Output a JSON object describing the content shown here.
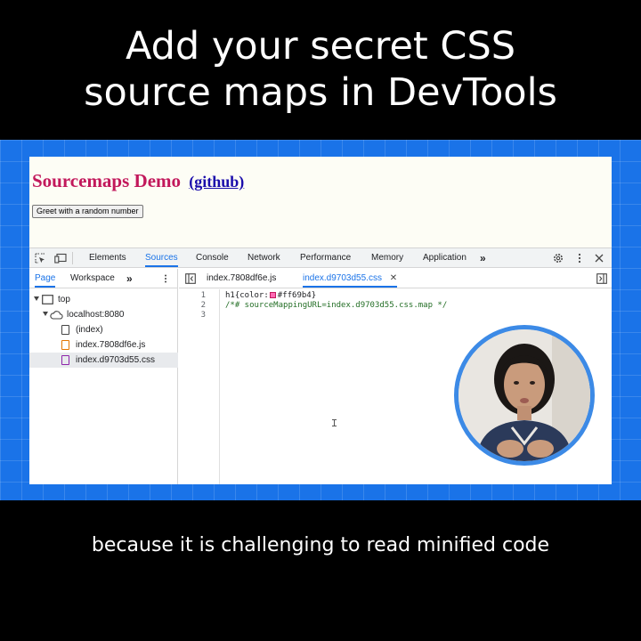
{
  "headline": {
    "line1": "Add your secret CSS",
    "line2": "source maps in DevTools"
  },
  "webpage": {
    "heading": "Sourcemaps Demo",
    "heading_link": "(github)",
    "greet_button": "Greet with a random number",
    "heading_color": "#c2185b"
  },
  "devtools": {
    "panels": [
      "Elements",
      "Sources",
      "Console",
      "Network",
      "Performance",
      "Memory",
      "Application"
    ],
    "active_panel": "Sources",
    "more_panels_icon": "chevron-double-right-icon",
    "navigator": {
      "tabs": [
        "Page",
        "Workspace"
      ],
      "active_tab": "Page",
      "tree": [
        {
          "label": "top",
          "icon": "frame-icon"
        },
        {
          "label": "localhost:8080",
          "icon": "cloud-icon"
        },
        {
          "label": "(index)",
          "icon": "document-icon"
        },
        {
          "label": "index.7808df6e.js",
          "icon": "js-file-icon"
        },
        {
          "label": "index.d9703d55.css",
          "icon": "css-file-icon",
          "selected": true
        }
      ]
    },
    "editor": {
      "tabs": [
        "index.7808df6e.js",
        "index.d9703d55.css"
      ],
      "active_tab": "index.d9703d55.css",
      "line_numbers": [
        "1",
        "2",
        "3"
      ],
      "lines": {
        "l1_prefix": "h1{color:",
        "l1_value": "#ff69b4}",
        "l2": "/*# sourceMappingURL=index.d9703d55.css.map */",
        "l3": ""
      },
      "swatch_color": "#ff69b4"
    }
  },
  "caption": "because it is challenging to read minified code",
  "colors": {
    "accent": "#1a73e8",
    "js_file": "#e37400",
    "css_file": "#8e24aa",
    "background": "#000000"
  }
}
